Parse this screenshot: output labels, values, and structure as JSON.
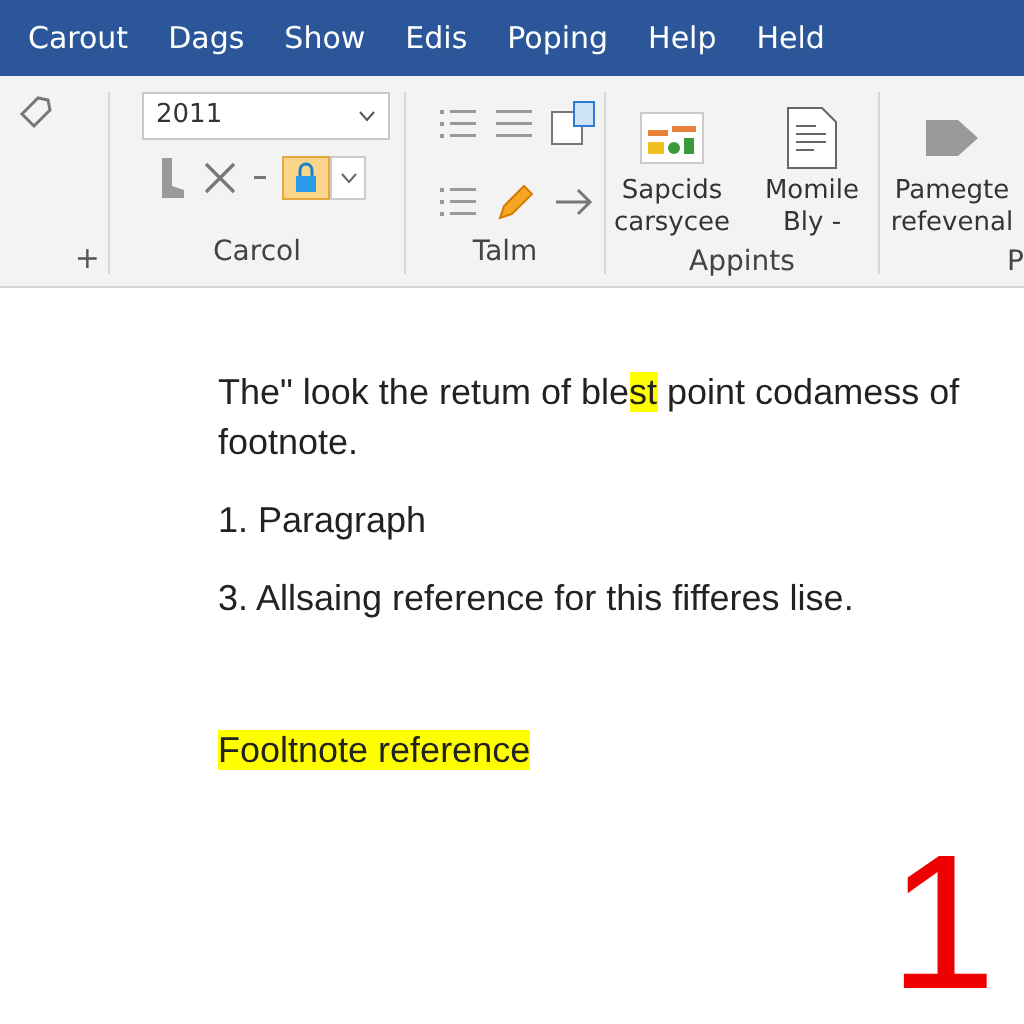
{
  "menu": [
    {
      "label": "Carout"
    },
    {
      "label": "Dags"
    },
    {
      "label": "Show"
    },
    {
      "label": "Edis"
    },
    {
      "label": "Poping"
    },
    {
      "label": "Help"
    },
    {
      "label": "Held"
    }
  ],
  "ribbon": {
    "left_button": "+",
    "groups": [
      {
        "label": "Carcol",
        "dropdown_value": "2011"
      },
      {
        "label": "Talm"
      },
      {
        "label": "Appints",
        "buttons": [
          {
            "label": "Sapcids carsycee",
            "kind": "chart"
          },
          {
            "label": "Momile Bly -",
            "kind": "doc"
          }
        ]
      },
      {
        "label": "P",
        "buttons": [
          {
            "label": "Pamegte refevenal",
            "kind": "arrow"
          }
        ]
      }
    ]
  },
  "document": {
    "paragraphs": [
      {
        "segments": [
          {
            "text": "The\" look the retum of ble",
            "highlight": false
          },
          {
            "text": "st",
            "highlight": true
          },
          {
            "text": " point codamess of footnote.",
            "highlight": false
          }
        ]
      },
      {
        "segments": [
          {
            "text": "1. Paragraph",
            "highlight": false
          }
        ]
      },
      {
        "segments": [
          {
            "text": "3. Allsaing reference for this fifferes lise.",
            "highlight": false
          }
        ]
      }
    ],
    "footnote": {
      "text": "Fooltnote reference",
      "highlight": true
    },
    "page_number": "1"
  }
}
